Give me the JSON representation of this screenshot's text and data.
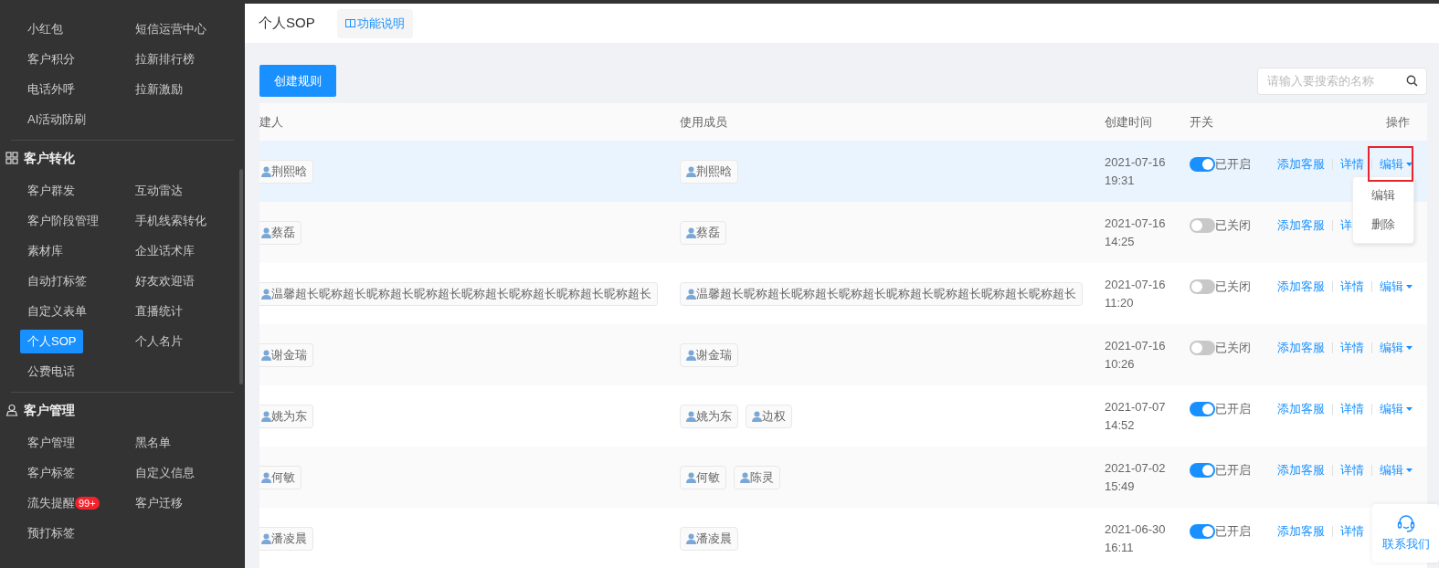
{
  "sidebar": {
    "groups": [
      {
        "items": [
          {
            "label": "小红包",
            "selected": false
          },
          {
            "label": "短信运营中心",
            "selected": false
          },
          {
            "label": "客户积分",
            "selected": false
          },
          {
            "label": "拉新排行榜",
            "selected": false
          },
          {
            "label": "电话外呼",
            "selected": false
          },
          {
            "label": "拉新激励",
            "selected": false
          },
          {
            "label": "AI活动防刷",
            "selected": false
          }
        ]
      },
      {
        "title": "客户转化",
        "items": [
          {
            "label": "客户群发",
            "selected": false
          },
          {
            "label": "互动雷达",
            "selected": false
          },
          {
            "label": "客户阶段管理",
            "selected": false
          },
          {
            "label": "手机线索转化",
            "selected": false
          },
          {
            "label": "素材库",
            "selected": false
          },
          {
            "label": "企业话术库",
            "selected": false
          },
          {
            "label": "自动打标签",
            "selected": false
          },
          {
            "label": "好友欢迎语",
            "selected": false
          },
          {
            "label": "自定义表单",
            "selected": false
          },
          {
            "label": "直播统计",
            "selected": false
          },
          {
            "label": "个人SOP",
            "selected": true
          },
          {
            "label": "个人名片",
            "selected": false
          },
          {
            "label": "公费电话",
            "selected": false
          }
        ]
      },
      {
        "title": "客户管理",
        "items": [
          {
            "label": "客户管理",
            "selected": false
          },
          {
            "label": "黑名单",
            "selected": false
          },
          {
            "label": "客户标签",
            "selected": false
          },
          {
            "label": "自定义信息",
            "selected": false
          },
          {
            "label": "流失提醒",
            "badge": "99+",
            "selected": false
          },
          {
            "label": "客户迁移",
            "selected": false
          },
          {
            "label": "预打标签",
            "selected": false
          }
        ]
      }
    ]
  },
  "header": {
    "title": "个人SOP",
    "help_tab": "功能说明"
  },
  "create_button": "创建规则",
  "search": {
    "placeholder": "请输入要搜索的名称"
  },
  "table": {
    "columns": [
      "建人",
      "使用成员",
      "创建时间",
      "开关",
      "操作"
    ],
    "rows": [
      {
        "hovered": true,
        "creator": "荆熙晗",
        "members": [
          "荆熙晗"
        ],
        "date": "2021-07-16",
        "time": "19:31",
        "on": true,
        "switch_label": "已开启",
        "actions": [
          "添加客服",
          "详情",
          "编辑"
        ]
      },
      {
        "hovered": false,
        "creator": "蔡磊",
        "members": [
          "蔡磊"
        ],
        "date": "2021-07-16",
        "time": "14:25",
        "on": false,
        "switch_label": "已关闭",
        "actions": [
          "添加客服",
          "详"
        ]
      },
      {
        "hovered": false,
        "creator": "温馨超长昵称超长昵称超长昵称超长昵称超长昵称超长昵称超长昵称超长",
        "members": [
          "温馨超长昵称超长昵称超长昵称超长昵称超长昵称超长昵称超长昵称超长"
        ],
        "date": "2021-07-16",
        "time": "11:20",
        "on": false,
        "switch_label": "已关闭",
        "actions": [
          "添加客服",
          "详情",
          "编辑"
        ]
      },
      {
        "hovered": false,
        "creator": "谢金瑞",
        "members": [
          "谢金瑞"
        ],
        "date": "2021-07-16",
        "time": "10:26",
        "on": false,
        "switch_label": "已关闭",
        "actions": [
          "添加客服",
          "详情",
          "编辑"
        ]
      },
      {
        "hovered": false,
        "creator": "姚为东",
        "members": [
          "姚为东",
          "边权"
        ],
        "date": "2021-07-07",
        "time": "14:52",
        "on": true,
        "switch_label": "已开启",
        "actions": [
          "添加客服",
          "详情",
          "编辑"
        ]
      },
      {
        "hovered": false,
        "creator": "何敏",
        "members": [
          "何敏",
          "陈灵"
        ],
        "date": "2021-07-02",
        "time": "15:49",
        "on": true,
        "switch_label": "已开启",
        "actions": [
          "添加客服",
          "详情",
          "编辑"
        ]
      },
      {
        "hovered": false,
        "creator": "潘凌晨",
        "members": [
          "潘凌晨"
        ],
        "date": "2021-06-30",
        "time": "16:11",
        "on": true,
        "switch_label": "已开启",
        "actions": [
          "添加客服",
          "详情"
        ]
      }
    ]
  },
  "dropdown": {
    "items": [
      "编辑",
      "删除"
    ]
  },
  "contact": {
    "label": "联系我们"
  }
}
